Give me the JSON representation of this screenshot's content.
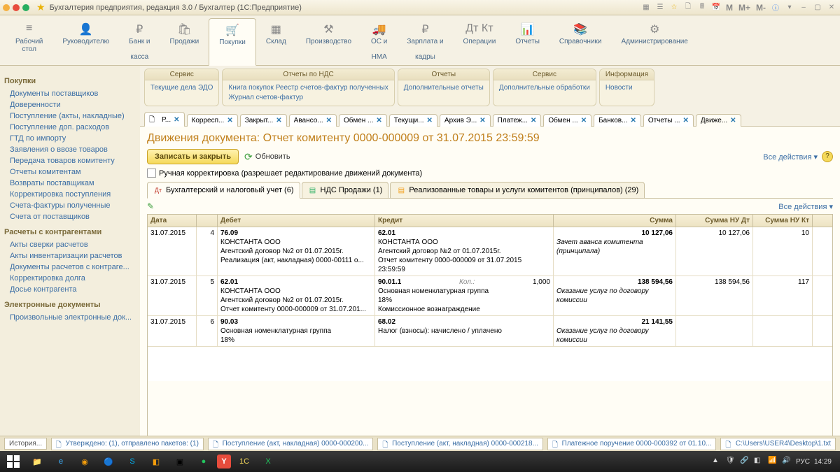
{
  "window": {
    "title": "Бухгалтерия предприятия, редакция 3.0 / Бухгалтер  (1С:Предприятие)",
    "m_buttons": [
      "M",
      "M+",
      "M-"
    ]
  },
  "mainnav": [
    {
      "label": "Рабочий стол",
      "glyph": "≡"
    },
    {
      "label": "Руководителю",
      "glyph": "👤"
    },
    {
      "label": "Банк и касса",
      "glyph": "₽"
    },
    {
      "label": "Продажи",
      "glyph": "🛍"
    },
    {
      "label": "Покупки",
      "glyph": "🛒",
      "active": true
    },
    {
      "label": "Склад",
      "glyph": "▦"
    },
    {
      "label": "Производство",
      "glyph": "⚒"
    },
    {
      "label": "ОС и НМА",
      "glyph": "🚚"
    },
    {
      "label": "Зарплата и кадры",
      "glyph": "₽"
    },
    {
      "label": "Операции",
      "glyph": "Дт Кт"
    },
    {
      "label": "Отчеты",
      "glyph": "📊"
    },
    {
      "label": "Справочники",
      "glyph": "📚"
    },
    {
      "label": "Администрирование",
      "glyph": "⚙"
    }
  ],
  "sidebar": {
    "groups": [
      {
        "title": "Покупки",
        "links": [
          "Документы поставщиков",
          "Доверенности",
          "Поступление (акты, накладные)",
          "Поступление доп. расходов",
          "ГТД по импорту",
          "Заявления о ввозе товаров",
          "Передача товаров комитенту",
          "Отчеты комитентам",
          "Возвраты поставщикам",
          "Корректировка поступления",
          "Счета-фактуры полученные",
          "Счета от поставщиков"
        ]
      },
      {
        "title": "Расчеты с контрагентами",
        "links": [
          "Акты сверки расчетов",
          "Акты инвентаризации расчетов",
          "Документы расчетов с контраге...",
          "Корректировка долга",
          "Досье контрагента"
        ]
      },
      {
        "title": "Электронные документы",
        "links": [
          "Произвольные электронные док..."
        ]
      }
    ]
  },
  "service_panels": [
    {
      "hdr": "Сервис",
      "lines": [
        "Текущие дела ЭДО"
      ]
    },
    {
      "hdr": "Отчеты по НДС",
      "lines": [
        "Книга покупок     Реестр счетов-фактур полученных",
        "Журнал счетов-фактур"
      ]
    },
    {
      "hdr": "Отчеты",
      "lines": [
        "Дополнительные отчеты"
      ]
    },
    {
      "hdr": "Сервис",
      "lines": [
        "Дополнительные обработки"
      ]
    },
    {
      "hdr": "Информация",
      "lines": [
        "Новости"
      ]
    }
  ],
  "tabs": [
    "Р...",
    "Корресп...",
    "Закрыт...",
    "Авансо...",
    "Обмен ...",
    "Текущи...",
    "Архив Э...",
    "Платеж...",
    "Обмен ...",
    "Банков...",
    "Отчеты ..."
  ],
  "active_tab": "Движе...",
  "document": {
    "title": "Движения документа: Отчет комитенту 0000-000009 от 31.07.2015 23:59:59",
    "save_close": "Записать и закрыть",
    "refresh": "Обновить",
    "all_actions": "Все действия",
    "manual_edit": "Ручная корректировка (разрешает редактирование движений документа)"
  },
  "inner_tabs": [
    {
      "label": "Бухгалтерский и налоговый учет (6)",
      "active": true
    },
    {
      "label": "НДС Продажи (1)"
    },
    {
      "label": "Реализованные товары и услуги комитентов (принципалов) (29)"
    }
  ],
  "grid": {
    "headers": [
      "Дата",
      "",
      "Дебет",
      "Кредит",
      "Сумма",
      "Сумма НУ Дт",
      "Сумма НУ Кт"
    ],
    "rows": [
      {
        "date": "31.07.2015",
        "n": "4",
        "deb": [
          "76.09",
          "КОНСТАНТА ООО",
          "Агентский договор №2 от 01.07.2015г.",
          "Реализация (акт, накладная) 0000-00111 о..."
        ],
        "cred": [
          "62.01",
          "КОНСТАНТА ООО",
          "Агентский договор №2 от 01.07.2015г.",
          "Отчет комитенту 0000-000009 от 31.07.2015 23:59:59"
        ],
        "sum": "10 127,06",
        "desc": "Зачет аванса комитента (принципала)",
        "nu1": "10 127,06",
        "nu2": "10"
      },
      {
        "date": "31.07.2015",
        "n": "5",
        "deb": [
          "62.01",
          "КОНСТАНТА ООО",
          "Агентский договор №2 от 01.07.2015г.",
          "Отчет комитенту 0000-000009 от 31.07.201..."
        ],
        "cred": [
          "90.01.1",
          "Основная номенклатурная группа",
          "18%",
          "Комиссионное вознаграждение"
        ],
        "kol": "Кол.:",
        "kolv": "1,000",
        "sum": "138 594,56",
        "desc": "Оказание услуг по договору комиссии",
        "nu1": "138 594,56",
        "nu2": "117"
      },
      {
        "date": "31.07.2015",
        "n": "6",
        "deb": [
          "90.03",
          "Основная номенклатурная группа",
          "18%",
          ""
        ],
        "cred": [
          "68.02",
          "Налог (взносы): начислено / уплачено",
          "",
          ""
        ],
        "sum": "21 141,55",
        "desc": "Оказание услуг по договору комиссии",
        "nu1": "",
        "nu2": ""
      }
    ]
  },
  "statusbar": {
    "history": "История...",
    "items": [
      "Утверждено: (1), отправлено пакетов: (1)",
      "Поступление (акт, накладная) 0000-000200...",
      "Поступление (акт, накладная) 0000-000218...",
      "Платежное поручение 0000-000392 от 01.10...",
      "C:\\Users\\USER4\\Desktop\\1.txt"
    ]
  },
  "taskbar": {
    "lang": "РУС",
    "time": "14:29"
  }
}
